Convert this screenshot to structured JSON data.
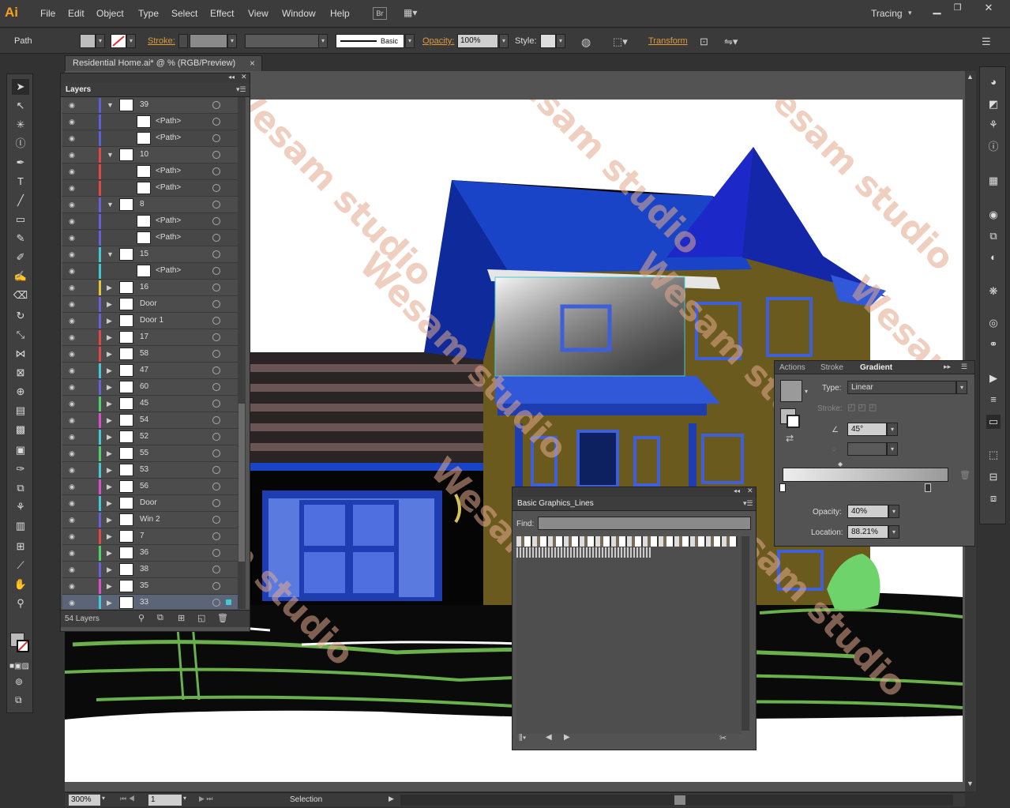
{
  "app": {
    "logo": "Ai",
    "workspace": "Tracing",
    "bridge_label": "Br"
  },
  "menu": [
    "File",
    "Edit",
    "Object",
    "Type",
    "Select",
    "Effect",
    "View",
    "Window",
    "Help"
  ],
  "control": {
    "object_type": "Path",
    "stroke_label": "Stroke:",
    "stroke_profile": "Basic",
    "opacity_label": "Opacity:",
    "opacity_value": "100%",
    "style_label": "Style:",
    "transform_label": "Transform"
  },
  "document": {
    "tab_title": "Residential Home.ai* @ % (RGB/Preview)",
    "close": "×"
  },
  "status": {
    "zoom": "300%",
    "artboard": "1",
    "tool": "Selection"
  },
  "layers": {
    "title": "Layers",
    "count": "54 Layers",
    "rows": [
      {
        "name": "39",
        "color": "#5b5fd8",
        "sub": false,
        "expanded": true
      },
      {
        "name": "<Path>",
        "color": "#5b5fd8",
        "sub": true
      },
      {
        "name": "<Path>",
        "color": "#5b5fd8",
        "sub": true
      },
      {
        "name": "10",
        "color": "#e04848",
        "sub": false,
        "expanded": true
      },
      {
        "name": "<Path>",
        "color": "#e04848",
        "sub": true
      },
      {
        "name": "<Path>",
        "color": "#e04848",
        "sub": true
      },
      {
        "name": "8",
        "color": "#6a5fd8",
        "sub": false,
        "expanded": true
      },
      {
        "name": "<Path>",
        "color": "#6a5fd8",
        "sub": true
      },
      {
        "name": "<Path>",
        "color": "#6a5fd8",
        "sub": true
      },
      {
        "name": "15",
        "color": "#45c8d5",
        "sub": false,
        "expanded": true
      },
      {
        "name": "<Path>",
        "color": "#45c8d5",
        "sub": true
      },
      {
        "name": "16",
        "color": "#e5c43a",
        "sub": false
      },
      {
        "name": "Door",
        "color": "#6a5fd8",
        "sub": false
      },
      {
        "name": "Door 1",
        "color": "#6a5fd8",
        "sub": false
      },
      {
        "name": "17",
        "color": "#e04848",
        "sub": false
      },
      {
        "name": "58",
        "color": "#e04848",
        "sub": false
      },
      {
        "name": "47",
        "color": "#45c8d5",
        "sub": false
      },
      {
        "name": "60",
        "color": "#6a5fd8",
        "sub": false
      },
      {
        "name": "45",
        "color": "#4ed36a",
        "sub": false
      },
      {
        "name": "54",
        "color": "#d84fc8",
        "sub": false
      },
      {
        "name": "52",
        "color": "#45c8d5",
        "sub": false
      },
      {
        "name": "55",
        "color": "#4ed36a",
        "sub": false
      },
      {
        "name": "53",
        "color": "#45c8d5",
        "sub": false
      },
      {
        "name": "56",
        "color": "#d84fc8",
        "sub": false
      },
      {
        "name": "Door",
        "color": "#45c8d5",
        "sub": false
      },
      {
        "name": "Win 2",
        "color": "#6a5fd8",
        "sub": false
      },
      {
        "name": "7",
        "color": "#e04848",
        "sub": false
      },
      {
        "name": "36",
        "color": "#4ed36a",
        "sub": false
      },
      {
        "name": "38",
        "color": "#6a5fd8",
        "sub": false
      },
      {
        "name": "35",
        "color": "#d84fc8",
        "sub": false
      },
      {
        "name": "33",
        "color": "#45c8d5",
        "sub": false,
        "selected": true
      }
    ]
  },
  "gradient": {
    "tabs": [
      "Actions",
      "Stroke",
      "Gradient"
    ],
    "type_label": "Type:",
    "type_value": "Linear",
    "stroke_label": "Stroke:",
    "angle_value": "45°",
    "opacity_label": "Opacity:",
    "opacity_value": "40%",
    "location_label": "Location:",
    "location_value": "88.21%"
  },
  "graphics": {
    "title": "Basic Graphics_Lines",
    "find_label": "Find:"
  },
  "watermark": "Wesam studio"
}
